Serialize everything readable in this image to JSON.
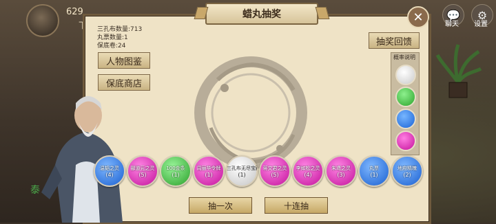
{
  "top": {
    "score": "629",
    "sub": "下",
    "chat_label": "聊天",
    "settings_label": "设置",
    "green_text": "泰"
  },
  "dialog": {
    "title": "蜡丸抽奖",
    "stats": [
      "三孔布数量:713",
      "丸票数量:1",
      "保底卷:24"
    ],
    "feedback_button": "抽奖回馈",
    "character_button": "人物图鉴",
    "shop_button": "保底商店",
    "odds_label": "概率说明",
    "odds_colors": [
      "#e8e8e8",
      "#3fbf3f",
      "#1f7ef0",
      "#e01fb4"
    ],
    "prizes": [
      {
        "name": "温韬之灵",
        "count": "(4)",
        "color": "blue"
      },
      {
        "name": "郦道元之灵",
        "count": "(5)",
        "color": "magenta"
      },
      {
        "name": "100金条",
        "count": "(1)",
        "color": "green"
      },
      {
        "name": "周丽华令牌",
        "count": "(1)",
        "color": "magenta"
      },
      {
        "name": "三孔布无尽宝藏",
        "count": "(1)",
        "color": "white"
      },
      {
        "name": "蒋文君之灵",
        "count": "(5)",
        "color": "magenta"
      },
      {
        "name": "李如松之灵",
        "count": "(4)",
        "color": "magenta"
      },
      {
        "name": "朱鸢之灵",
        "count": "(3)",
        "color": "magenta"
      },
      {
        "name": "丸票",
        "count": "(1)",
        "color": "blue"
      },
      {
        "name": "地府精魄",
        "count": "(2)",
        "color": "blue"
      }
    ],
    "draw_one": "抽一次",
    "draw_ten": "十连抽"
  }
}
